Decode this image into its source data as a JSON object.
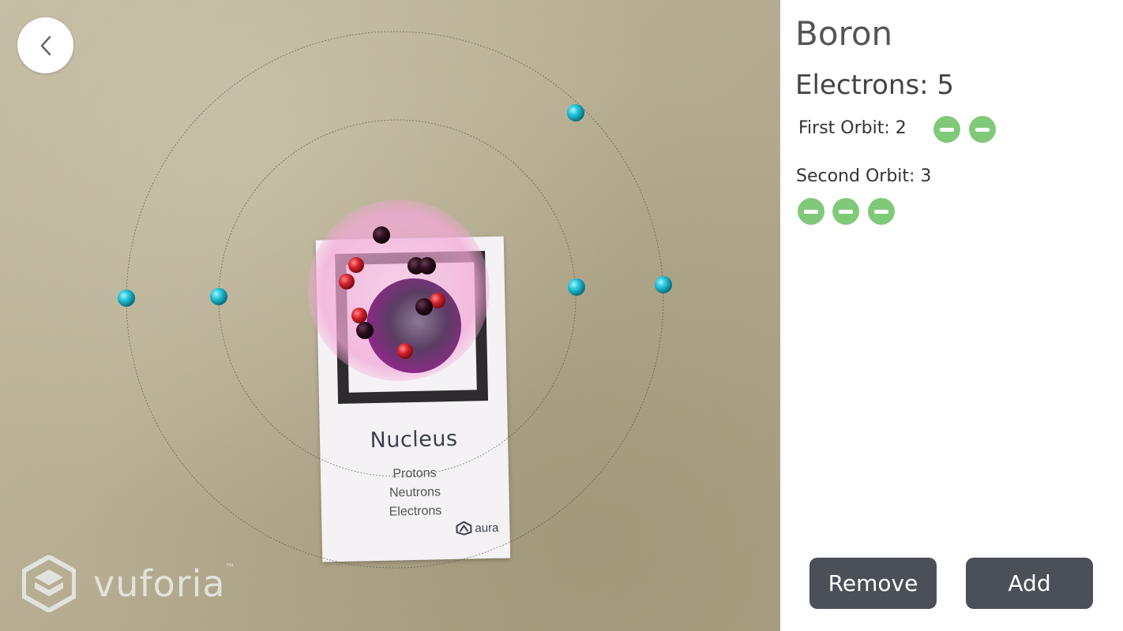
{
  "ar_view": {
    "back_icon": "chevron-left-icon",
    "marker_card": {
      "title": "Nucleus",
      "lines": [
        "Protons",
        "Neutrons",
        "Electrons"
      ],
      "logo_text": "aura"
    },
    "watermark": {
      "text": "vuforia",
      "tm": "™"
    },
    "colors": {
      "electron": "#26c3d6",
      "proton": "#d8262f",
      "neutron": "#2a0c1c",
      "nucleus_glow": "#f3a7d6"
    }
  },
  "panel": {
    "element_name": "Boron",
    "electrons_label": "Electrons: 5",
    "orbits": [
      {
        "label": "First Orbit: 2",
        "electrons": 2
      },
      {
        "label": "Second Orbit: 3",
        "electrons": 3
      }
    ],
    "remove_icon": "minus-circle-icon",
    "remove_label": "Remove",
    "add_label": "Add",
    "colors": {
      "remove_icon": "#7fc978",
      "button_bg": "#4a4f58"
    }
  }
}
